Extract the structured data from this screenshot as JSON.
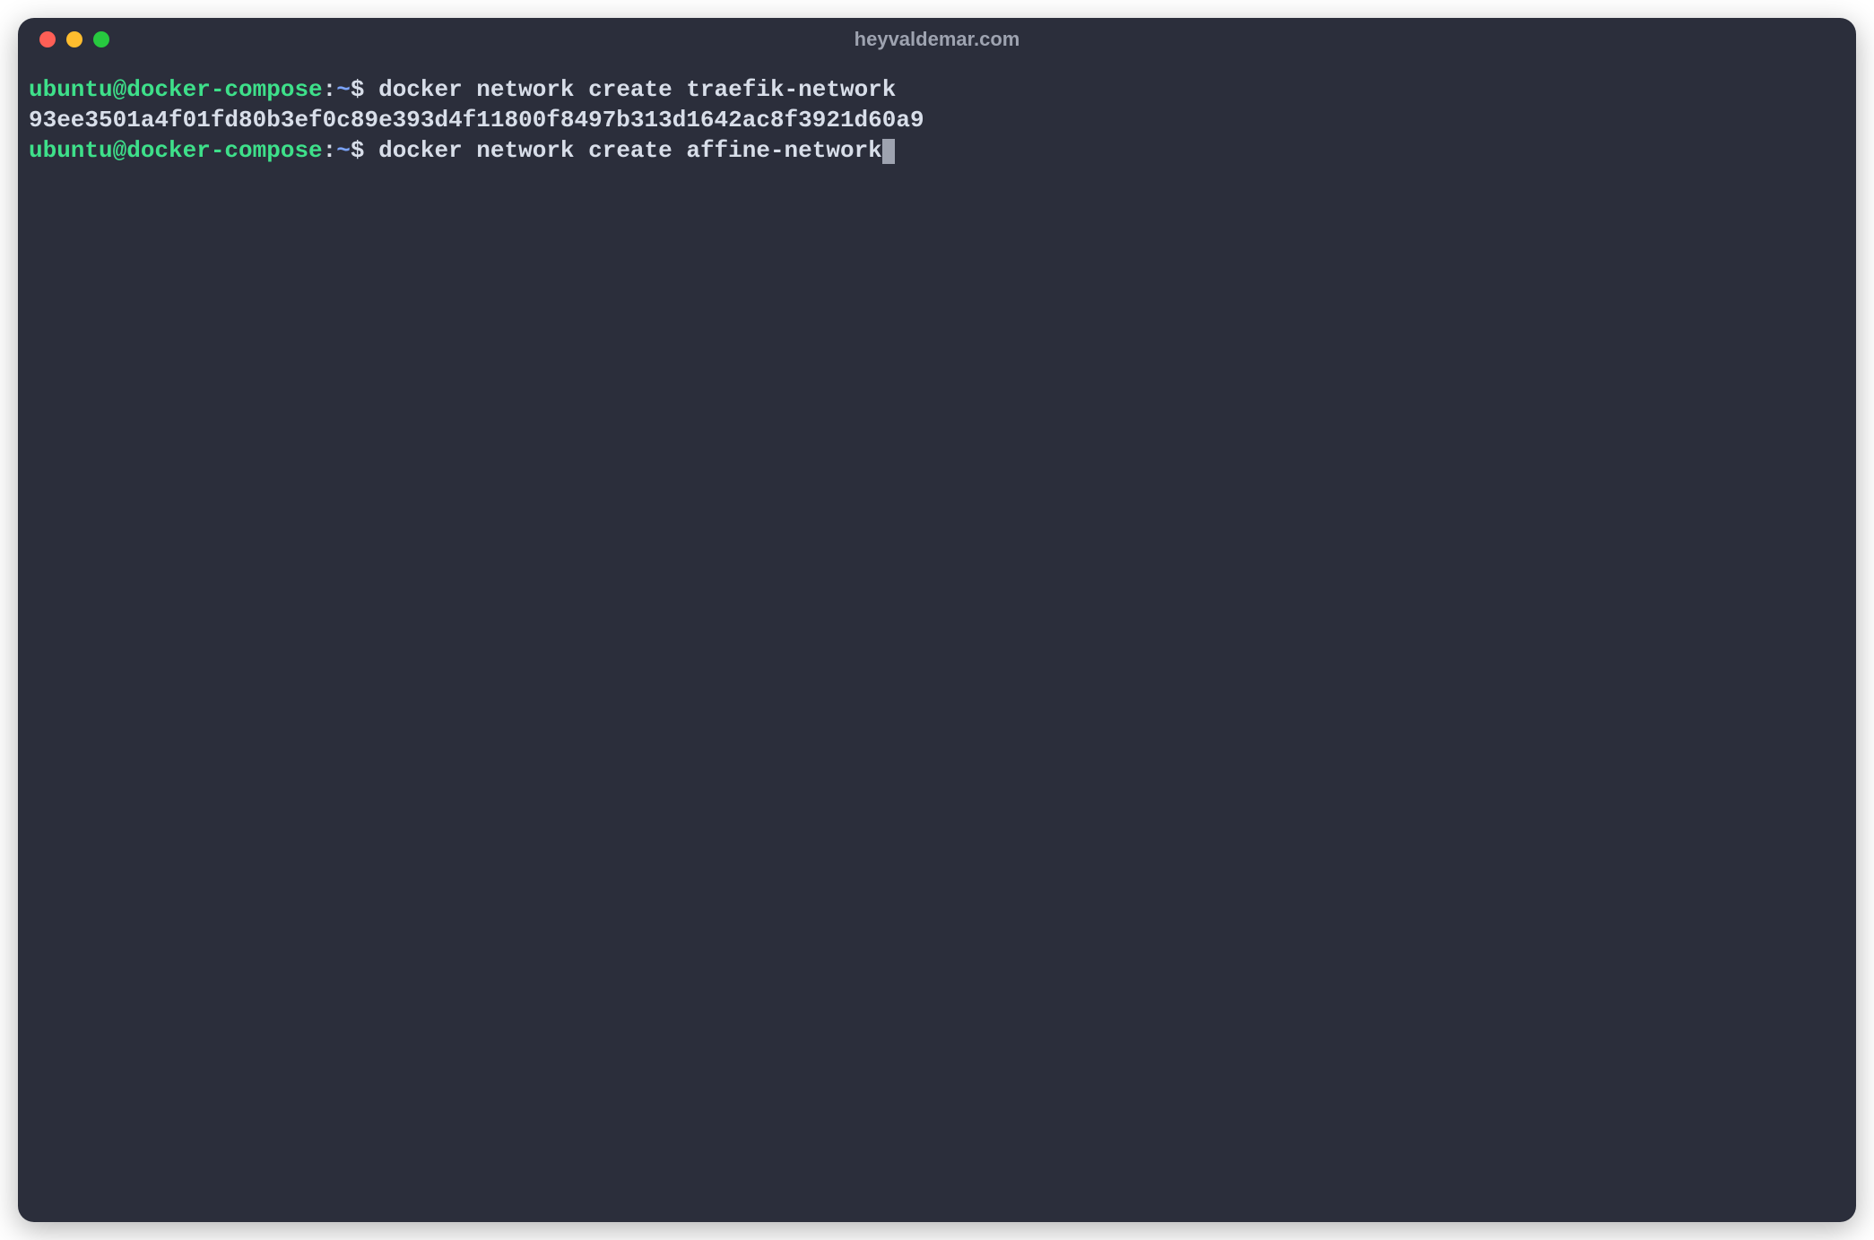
{
  "titlebar": {
    "title": "heyvaldemar.com"
  },
  "prompt": {
    "user_host": "ubuntu@docker-compose",
    "colon": ":",
    "path": "~",
    "symbol": "$"
  },
  "lines": [
    {
      "command": " docker network create traefik-network"
    },
    {
      "output": "93ee3501a4f01fd80b3ef0c89e393d4f11800f8497b313d1642ac8f3921d60a9"
    },
    {
      "command": " docker network create affine-network"
    }
  ]
}
